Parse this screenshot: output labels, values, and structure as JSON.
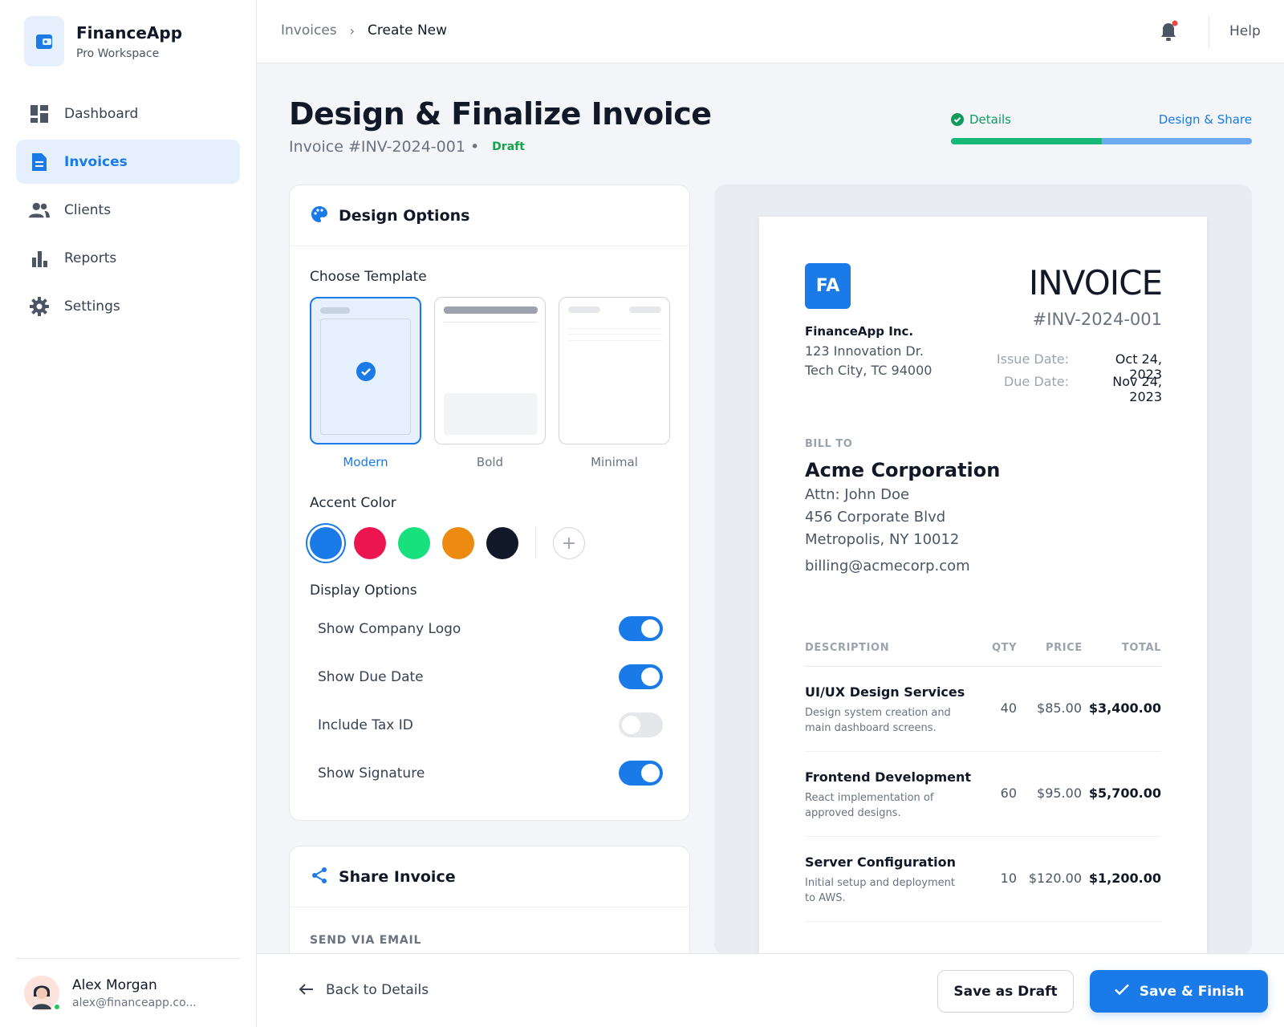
{
  "app": {
    "name": "FinanceApp",
    "workspace": "Pro Workspace"
  },
  "nav": [
    {
      "label": "Dashboard",
      "icon": "dashboard-icon"
    },
    {
      "label": "Invoices",
      "icon": "document-icon",
      "active": true
    },
    {
      "label": "Clients",
      "icon": "users-icon"
    },
    {
      "label": "Reports",
      "icon": "bar-chart-icon"
    },
    {
      "label": "Settings",
      "icon": "gear-icon"
    }
  ],
  "user": {
    "name": "Alex Morgan",
    "email": "alex@financeapp.co..."
  },
  "breadcrumb": {
    "parent": "Invoices",
    "current": "Create New",
    "separator": "›"
  },
  "header": {
    "help": "Help"
  },
  "page": {
    "title": "Design & Finalize Invoice",
    "invoice_ref": "Invoice #INV-2024-001 •",
    "status": "Draft"
  },
  "stepper": {
    "step1": "Details",
    "step2": "Design & Share",
    "progress": 0.5
  },
  "design": {
    "title": "Design Options",
    "choose_template": "Choose Template",
    "templates": [
      "Modern",
      "Bold",
      "Minimal"
    ],
    "selected_template": "Modern",
    "accent_label": "Accent Color",
    "colors": [
      "#1a7ae8",
      "#ec1550",
      "#18e07c",
      "#ec8a12",
      "#111827"
    ],
    "selected_color": "#1a7ae8",
    "display_label": "Display Options",
    "options": [
      {
        "label": "Show Company Logo",
        "on": true
      },
      {
        "label": "Show Due Date",
        "on": true
      },
      {
        "label": "Include Tax ID",
        "on": false
      },
      {
        "label": "Show Signature",
        "on": true
      }
    ]
  },
  "share": {
    "title": "Share Invoice",
    "send_label": "SEND VIA EMAIL"
  },
  "invoice": {
    "logo": "FA",
    "heading": "INVOICE",
    "number": "#INV-2024-001",
    "from": {
      "name": "FinanceApp Inc.",
      "line1": "123 Innovation Dr.",
      "line2": "Tech City, TC 94000"
    },
    "issue_label": "Issue Date:",
    "issue_date": "Oct 24, 2023",
    "due_label": "Due Date:",
    "due_date": "Nov 24, 2023",
    "bill_to_label": "BILL TO",
    "bill_to": {
      "name": "Acme Corporation",
      "attn": "Attn: John Doe",
      "addr1": "456 Corporate Blvd",
      "addr2": "Metropolis, NY 10012",
      "email": "billing@acmecorp.com"
    },
    "columns": {
      "description": "DESCRIPTION",
      "qty": "QTY",
      "price": "PRICE",
      "total": "TOTAL"
    },
    "items": [
      {
        "title": "UI/UX Design Services",
        "desc": "Design system creation and main dashboard screens.",
        "qty": "40",
        "price": "$85.00",
        "total": "$3,400.00"
      },
      {
        "title": "Frontend Development",
        "desc": "React implementation of approved designs.",
        "qty": "60",
        "price": "$95.00",
        "total": "$5,700.00"
      },
      {
        "title": "Server Configuration",
        "desc": "Initial setup and deployment to AWS.",
        "qty": "10",
        "price": "$120.00",
        "total": "$1,200.00"
      }
    ]
  },
  "footer": {
    "back": "Back to Details",
    "save_draft": "Save as Draft",
    "save_finish": "Save & Finish"
  }
}
